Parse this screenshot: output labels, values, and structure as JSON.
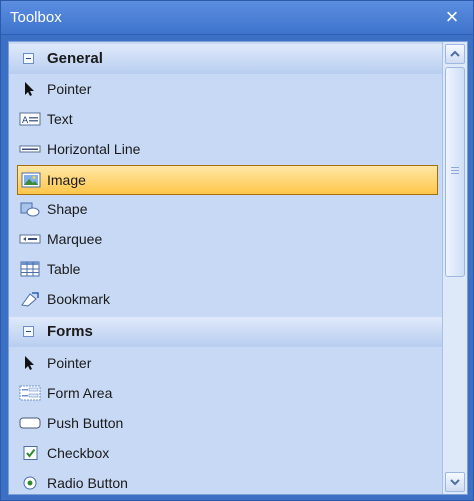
{
  "window": {
    "title": "Toolbox",
    "close_glyph": "×"
  },
  "categories": [
    {
      "label": "General",
      "items": [
        {
          "label": "Pointer",
          "icon": "pointer-icon"
        },
        {
          "label": "Text",
          "icon": "text-icon"
        },
        {
          "label": "Horizontal Line",
          "icon": "horizontal-line-icon"
        },
        {
          "label": "Image",
          "icon": "image-icon",
          "selected": true
        },
        {
          "label": "Shape",
          "icon": "shape-icon"
        },
        {
          "label": "Marquee",
          "icon": "marquee-icon"
        },
        {
          "label": "Table",
          "icon": "table-icon"
        },
        {
          "label": "Bookmark",
          "icon": "bookmark-icon"
        }
      ]
    },
    {
      "label": "Forms",
      "items": [
        {
          "label": "Pointer",
          "icon": "pointer-icon"
        },
        {
          "label": "Form Area",
          "icon": "form-area-icon"
        },
        {
          "label": "Push Button",
          "icon": "push-button-icon"
        },
        {
          "label": "Checkbox",
          "icon": "checkbox-icon"
        },
        {
          "label": "Radio Button",
          "icon": "radio-button-icon"
        }
      ]
    }
  ],
  "colors": {
    "titlebar": "#3f74cc",
    "panel": "#c7d9f4",
    "selection": "#ffc64a"
  }
}
